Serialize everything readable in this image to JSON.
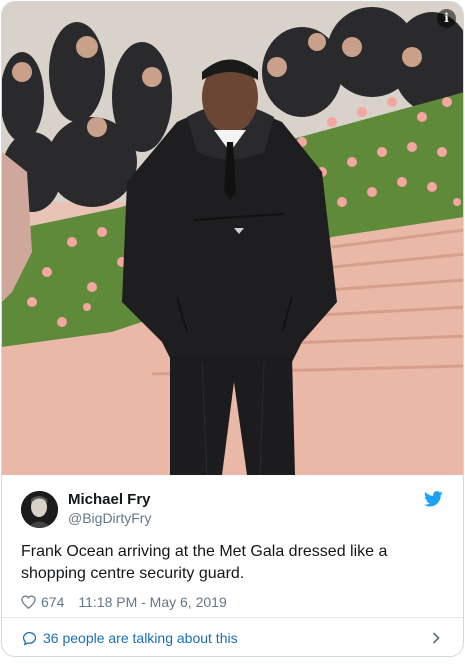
{
  "photo": {
    "info_icon": "info-icon",
    "colors": {
      "carpet": "#e9b8a6",
      "hedge": "#5e8a3a",
      "roses": "#f3a7a0",
      "jacket": "#1e1e20"
    }
  },
  "tweet": {
    "author": {
      "display_name": "Michael Fry",
      "handle": "@BigDirtyFry"
    },
    "text": "Frank Ocean arriving at the Met Gala dressed like a shopping centre security guard.",
    "likes": "674",
    "timestamp": "11:18 PM - May 6, 2019",
    "conversation_link": "36 people are talking about this"
  },
  "icons": {
    "brand": "twitter-bird-icon",
    "like": "heart-icon",
    "reply": "speech-bubble-icon",
    "more": "chevron-right-icon"
  },
  "colors": {
    "twitter_blue": "#1da1f2",
    "link_blue": "#1b6fb5",
    "secondary_text": "#657786"
  }
}
